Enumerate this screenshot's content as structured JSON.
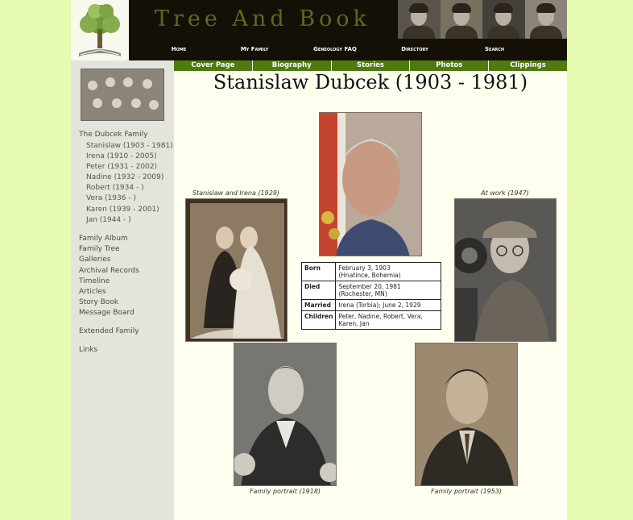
{
  "site": {
    "title": "Tree And Book"
  },
  "top_nav": [
    "Home",
    "My Family",
    "Geneology FAQ",
    "Directory",
    "Search"
  ],
  "tabs": [
    "Cover Page",
    "Biography",
    "Stories",
    "Photos",
    "Clippings"
  ],
  "sidebar": {
    "family_heading": "The Dubcek Family",
    "members": [
      "Stanislaw (1903 - 1981)",
      "Irena (1910 - 2005)",
      "Peter (1931 - 2002)",
      "Nadine (1932 - 2009)",
      "Robert (1934 - )",
      "Vera (1936 - )",
      "Karen (1939 - 2001)",
      "Jan (1944 - )"
    ],
    "links": [
      "Family Album",
      "Family Tree",
      "Galleries",
      "Archival Records",
      "Timeline",
      "Articles",
      "Story Book",
      "Message Board"
    ],
    "extended": "Extended Family",
    "links_label": "Links"
  },
  "person": {
    "name": "Stanislaw Dubcek (1903 - 1981)"
  },
  "captions": {
    "wedding": "Stanislaw and Irena (1929)",
    "work": "At work (1947)",
    "portrait_1918": "Family portrait (1918)",
    "portrait_1953": "Family portrait (1953)"
  },
  "info": [
    {
      "label": "Born",
      "value": "February 3, 1903\n(Hnatince, Bohemia)"
    },
    {
      "label": "Died",
      "value": "September 20, 1981\n(Rochester, MN)"
    },
    {
      "label": "Married",
      "value": "Irena (Torbia); June 2, 1929"
    },
    {
      "label": "Children",
      "value": "Peter, Nadine, Robert, Vera, Karen, Jan"
    }
  ],
  "colors": {
    "background": "#e6fbb0",
    "header": "#141008",
    "tab": "#4e7a10",
    "content": "#fffff0",
    "sidebar": "#e4e4dc"
  }
}
